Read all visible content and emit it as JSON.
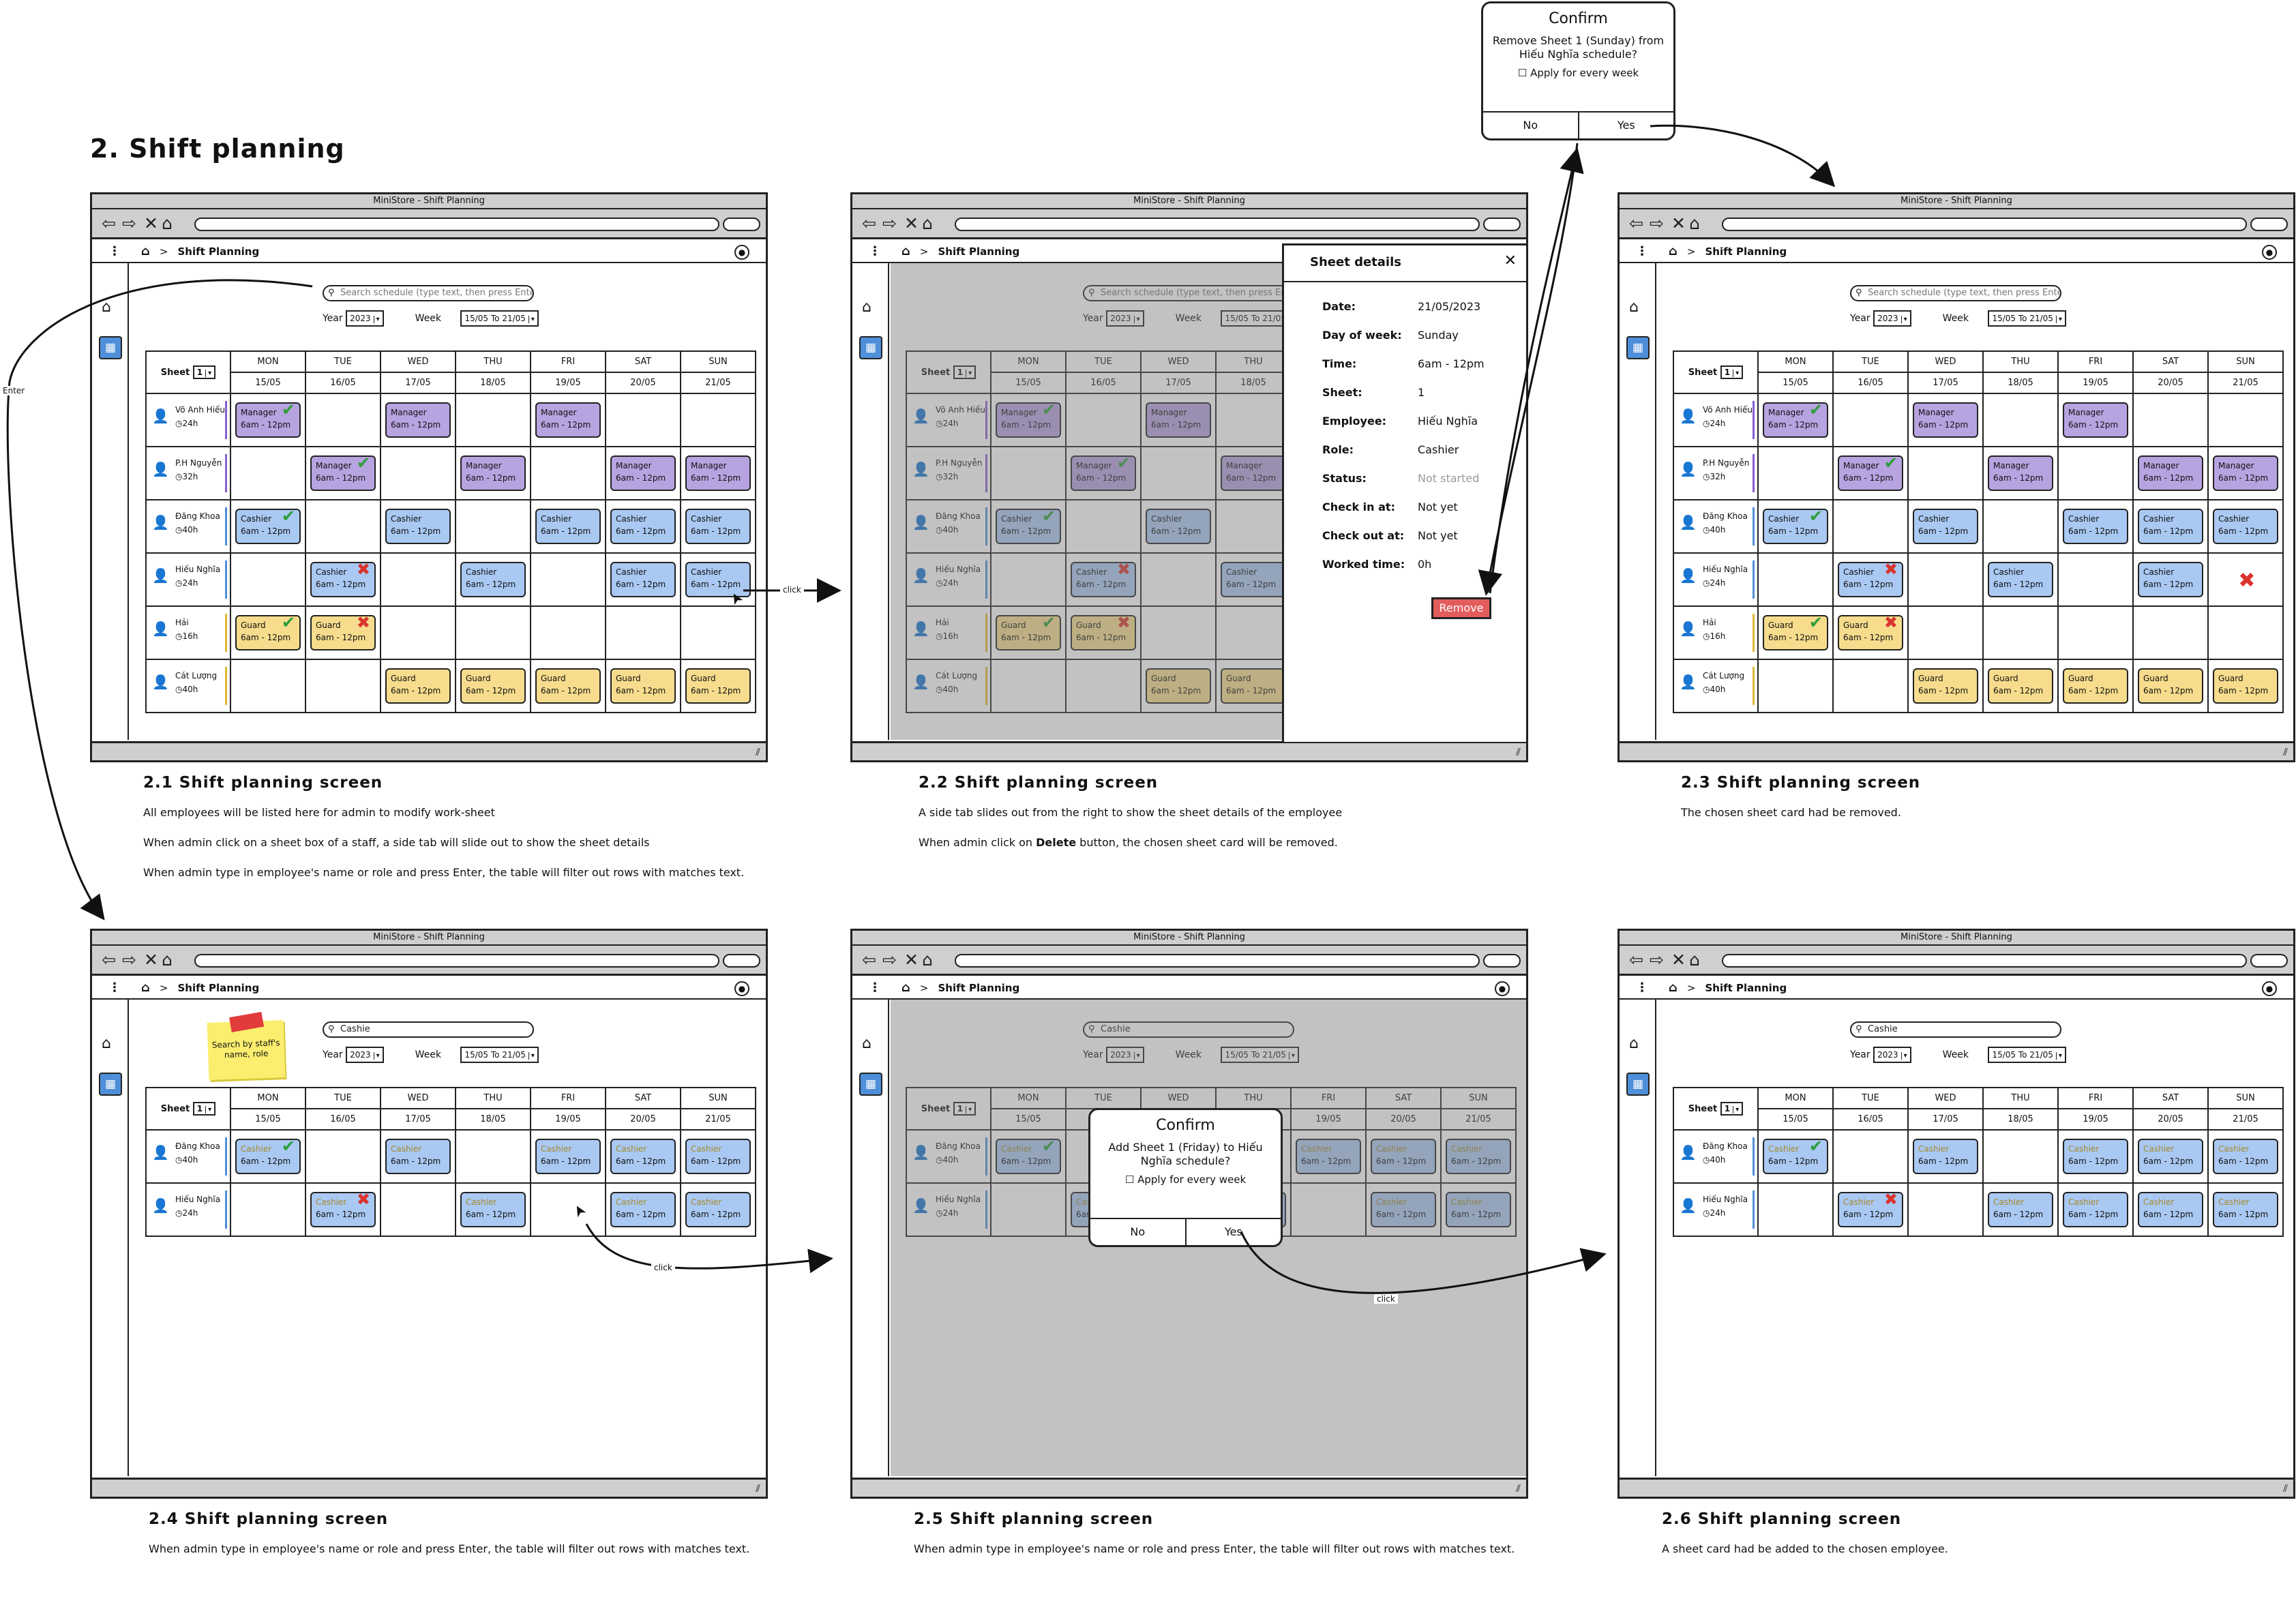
{
  "page": {
    "title": "2. Shift planning"
  },
  "window": {
    "title": "MiniStore - Shift Planning",
    "breadcrumb": "Shift Planning",
    "search_placeholder": "Search schedule (type text, then press Enter)",
    "search_value": "Cashie",
    "year_label": "Year",
    "year_value": "2023",
    "week_label": "Week",
    "week_value": "15/05 To 21/05",
    "sheet_label": "Sheet",
    "sheet_value": "1"
  },
  "days": [
    {
      "dow": "MON",
      "date": "15/05"
    },
    {
      "dow": "TUE",
      "date": "16/05"
    },
    {
      "dow": "WED",
      "date": "17/05"
    },
    {
      "dow": "THU",
      "date": "18/05"
    },
    {
      "dow": "FRI",
      "date": "19/05"
    },
    {
      "dow": "SAT",
      "date": "20/05"
    },
    {
      "dow": "SUN",
      "date": "21/05"
    }
  ],
  "shift_time": "6am - 12pm",
  "colors": {
    "manager": "#b7a3e0",
    "cashier": "#a9c8f2",
    "guard": "#f6dc8c",
    "check": "#2e9d3a",
    "cross": "#d9342e",
    "calendar_icon": "#4f8fd9",
    "remove_button": "#e25c5c"
  },
  "employees": [
    {
      "name": "Võ Anh Hiếu",
      "hours": "24h",
      "role": "Manager",
      "bar": "#8a5fd0",
      "cells": [
        "ok",
        "",
        "plain",
        "",
        "plain",
        "",
        ""
      ]
    },
    {
      "name": "P.H Nguyễn",
      "hours": "32h",
      "role": "Manager",
      "bar": "#8a5fd0",
      "cells": [
        "",
        "ok",
        "",
        "plain",
        "",
        "plain",
        "plain"
      ]
    },
    {
      "name": "Đăng Khoa",
      "hours": "40h",
      "role": "Cashier",
      "bar": "#4f8fd9",
      "cells": [
        "ok",
        "",
        "plain",
        "",
        "plain",
        "plain",
        "plain"
      ]
    },
    {
      "name": "Hiếu Nghĩa",
      "hours": "24h",
      "role": "Cashier",
      "bar": "#4f8fd9",
      "cells": [
        "",
        "no",
        "",
        "plain",
        "",
        "plain",
        "plain"
      ]
    },
    {
      "name": "Hải",
      "hours": "16h",
      "role": "Guard",
      "bar": "#e0b93a",
      "cells": [
        "ok",
        "no",
        "",
        "",
        "",
        "",
        ""
      ]
    },
    {
      "name": "Cát Lượng",
      "hours": "40h",
      "role": "Guard",
      "bar": "#e0b93a",
      "cells": [
        "",
        "",
        "plain",
        "plain",
        "plain",
        "plain",
        "plain"
      ]
    }
  ],
  "captions": [
    {
      "title": "2.1 Shift planning screen",
      "lines": [
        "All employees will be listed here for admin to modify work-sheet",
        "When admin click on a sheet box of a staff, a side tab will slide out to show the sheet details",
        "When admin type in employee's name or role and press Enter, the table will filter out rows with matches text."
      ]
    },
    {
      "title": "2.2 Shift planning screen",
      "lines": [
        "A side tab slides out from the right to show the sheet details of the employee"
      ],
      "line2_pre": "When admin click on ",
      "line2_bold": "Delete",
      "line2_post": " button, the chosen sheet card will be removed."
    },
    {
      "title": "2.3 Shift planning screen",
      "lines": [
        "The chosen sheet card had be removed."
      ]
    },
    {
      "title": "2.4 Shift planning screen",
      "lines": [
        "When admin type in employee's name or role and press Enter, the table will filter out rows with matches text."
      ]
    },
    {
      "title": "2.5 Shift planning screen",
      "lines": [
        "When admin type in employee's name or role and press Enter, the table will filter out rows with matches text."
      ]
    },
    {
      "title": "2.6 Shift planning screen",
      "lines": [
        "A sheet card had be added to the chosen employee."
      ]
    }
  ],
  "sheet_details": {
    "title": "Sheet details",
    "rows": [
      {
        "k": "Date:",
        "v": "21/05/2023"
      },
      {
        "k": "Day of week:",
        "v": "Sunday"
      },
      {
        "k": "Time:",
        "v": "6am - 12pm"
      },
      {
        "k": "Sheet:",
        "v": "1"
      },
      {
        "k": "Employee:",
        "v": "Hiếu Nghĩa"
      },
      {
        "k": "Role:",
        "v": "Cashier"
      },
      {
        "k": "Status:",
        "v": "Not started"
      },
      {
        "k": "Check in at:",
        "v": "Not yet"
      },
      {
        "k": "Check out at:",
        "v": "Not yet"
      },
      {
        "k": "Worked time:",
        "v": "0h"
      }
    ],
    "remove_label": "Remove"
  },
  "confirm_remove": {
    "title": "Confirm",
    "message": "Remove Sheet 1 (Sunday) from Hiếu Nghĩa schedule?",
    "checkbox": "Apply for every week",
    "no": "No",
    "yes": "Yes"
  },
  "confirm_add": {
    "title": "Confirm",
    "message": "Add Sheet 1 (Friday) to Hiếu Nghĩa schedule?",
    "checkbox": "Apply for every week",
    "no": "No",
    "yes": "Yes"
  },
  "sticky_note": "Search by staff's name, role",
  "flow_labels": {
    "enter": "Enter",
    "click": "click"
  }
}
